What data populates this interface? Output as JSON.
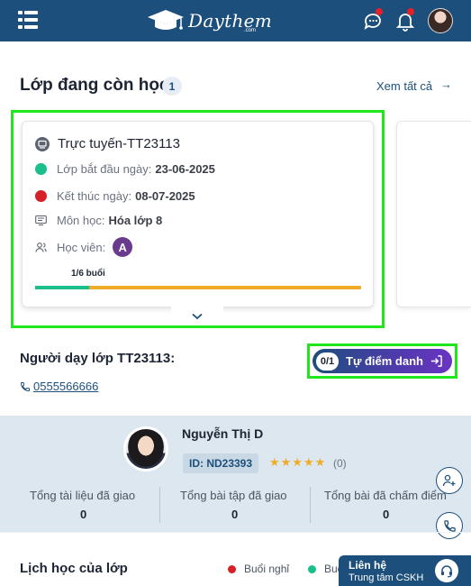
{
  "header": {
    "logo_text": "Daythem",
    "logo_sub": ".com"
  },
  "section": {
    "title": "Lớp đang còn học",
    "count": "1",
    "see_all": "Xem tất cả",
    "see_all_arrow": "→"
  },
  "class_card": {
    "title": "Trực tuyến-TT23113",
    "start_label": "Lớp bắt đầu ngày:",
    "start_date": "23-06-2025",
    "end_label": "Kết thúc ngày:",
    "end_date": "08-07-2025",
    "subject_label": "Môn học:",
    "subject": "Hóa lớp 8",
    "students_label": "Học viên:",
    "student_avatar": "A",
    "progress_label": "1/6 buổi",
    "progress_fraction": 0.1667
  },
  "teacher": {
    "title": "Người dạy lớp TT23113:",
    "phone": "0555566666",
    "name": "Nguyễn Thị D",
    "id": "ID: ND23393",
    "stars": "★★★★★",
    "rating": "(0)"
  },
  "checkin": {
    "count": "0/1",
    "label": "Tự điểm danh"
  },
  "stats": [
    {
      "label": "Tổng tài liệu đã giao",
      "value": "0"
    },
    {
      "label": "Tổng bài tập đã giao",
      "value": "0"
    },
    {
      "label": "Tổng bài đã chấm điểm",
      "value": "0"
    }
  ],
  "schedule": {
    "title": "Lịch học của lớp",
    "legend_off": "Buổi nghỉ",
    "legend_other": "Buổ"
  },
  "support": {
    "title": "Liên hệ",
    "subtitle": "Trung tâm CSKH"
  },
  "colors": {
    "primary": "#1c4f7c",
    "accent_green": "#1abf8c",
    "accent_red": "#d61f26",
    "accent_orange": "#f0ab27",
    "highlight": "#22e61c"
  },
  "icons": [
    "menu-icon",
    "graduation-cap-icon",
    "chat-icon",
    "bell-icon",
    "monitor-icon",
    "book-icon",
    "users-icon",
    "phone-icon",
    "login-icon",
    "chevron-down-icon",
    "add-user-icon",
    "headset-icon"
  ]
}
